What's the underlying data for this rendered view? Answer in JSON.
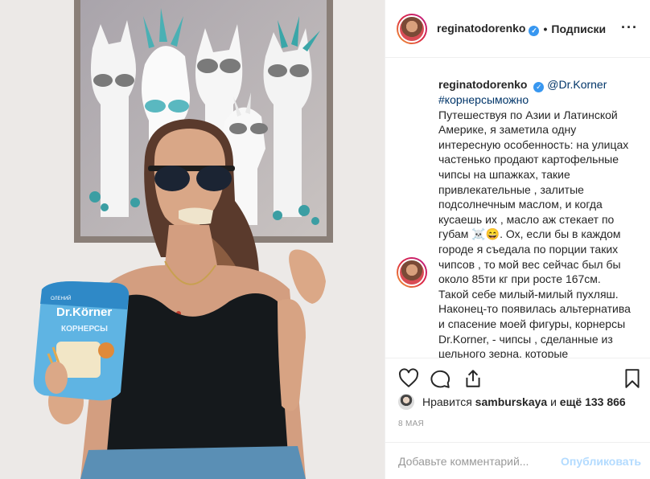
{
  "header": {
    "username": "reginatodorenko",
    "verified_icon": "verified-badge-icon",
    "separator": "•",
    "follow_label": "Подписки",
    "more_icon": "more-options-icon"
  },
  "caption": {
    "username": "reginatodorenko",
    "mention": "@Dr.Korner",
    "hashtag": "#корнерсыможно",
    "lines": [
      "Путешествуя по Азии и Латинской",
      "Америке, я заметила одну",
      "интересную особенность: на улицах",
      "частенько продают картофельные",
      "чипсы на шпажках, такие",
      "привлекательные , залитые",
      "подсолнечным маслом, и когда",
      "кусаешь их , масло аж стекает по",
      "губам ☠️😄. Ох, если бы в каждом",
      "городе я съедала по порции таких",
      "чипсов , то мой вес сейчас был бы",
      "около 85ти кг при росте 167см.",
      "Такой себе милый-милый пухляш.",
      "Наконец-то появилась альтернатива",
      "и спасение моей фигуры, корнерсы",
      "Dr.Korner, - чипсы , сделанные из",
      "цельного зерна, которые"
    ]
  },
  "actions": {
    "like_icon": "heart-icon",
    "comment_icon": "comment-icon",
    "share_icon": "share-icon",
    "save_icon": "bookmark-icon"
  },
  "likes": {
    "prefix": "Нравится",
    "user": "samburskaya",
    "middle": "и",
    "count": "ещё 133 866"
  },
  "date": "8 МАЯ",
  "comment_box": {
    "placeholder": "Добавьте комментарий...",
    "publish_label": "Опубликовать"
  },
  "photo": {
    "package_brand": "Dr.Körner",
    "package_title": "КОРНЕРСЫ",
    "package_top": "ОЛЕНИЙ"
  },
  "colors": {
    "link": "#003569",
    "publish_disabled": "#b3dbff",
    "verified": "#3897f0"
  }
}
